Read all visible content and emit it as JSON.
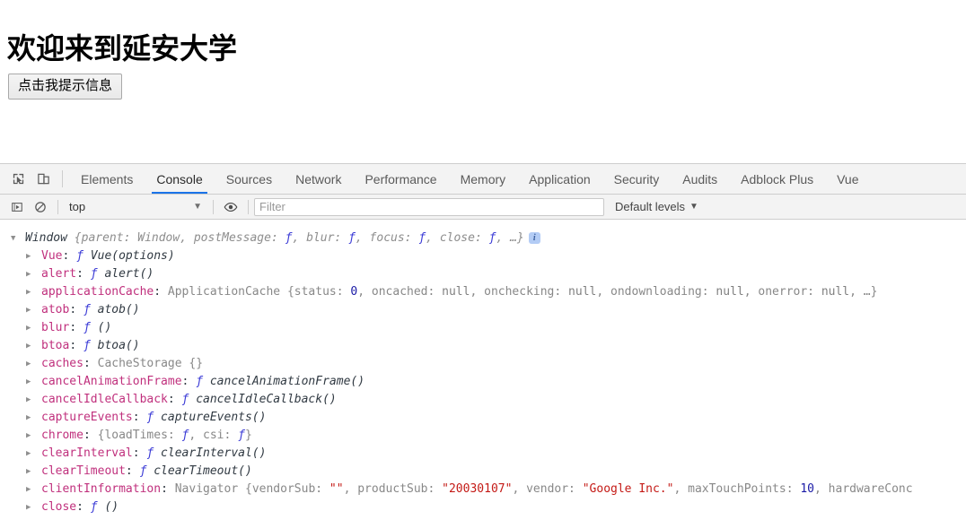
{
  "page": {
    "heading": "欢迎来到延安大学",
    "button_label": "点击我提示信息"
  },
  "devtools": {
    "icons": {
      "inspect": "inspect-element-icon",
      "device": "device-toolbar-icon",
      "execute": "execute-snippet-icon",
      "clear": "clear-console-icon",
      "eye": "live-expression-icon"
    },
    "tabs": [
      {
        "label": "Elements",
        "active": false
      },
      {
        "label": "Console",
        "active": true
      },
      {
        "label": "Sources",
        "active": false
      },
      {
        "label": "Network",
        "active": false
      },
      {
        "label": "Performance",
        "active": false
      },
      {
        "label": "Memory",
        "active": false
      },
      {
        "label": "Application",
        "active": false
      },
      {
        "label": "Security",
        "active": false
      },
      {
        "label": "Audits",
        "active": false
      },
      {
        "label": "Adblock Plus",
        "active": false
      },
      {
        "label": "Vue",
        "active": false
      }
    ],
    "filterbar": {
      "context": "top",
      "caret": "▼",
      "filter_placeholder": "Filter",
      "filter_value": "",
      "levels": "Default levels",
      "levels_caret": "▼"
    },
    "colors": {
      "accent": "#1a73e8",
      "property": "#c0307d",
      "string": "#c41a16",
      "number": "#1a1aa6",
      "function": "#3b3bd6",
      "dim": "#8d8d8d",
      "toolbar_bg": "#f3f3f3",
      "border": "#cdcdcd"
    },
    "console_rows": [
      {
        "indent": "root",
        "arrow": "▼",
        "badge": "i",
        "segments": [
          {
            "t": "Window ",
            "c": "k-win"
          },
          {
            "t": "{parent: Window, postMessage: ",
            "c": "k-type"
          },
          {
            "t": "ƒ",
            "c": "k-fn"
          },
          {
            "t": ", blur: ",
            "c": "k-type"
          },
          {
            "t": "ƒ",
            "c": "k-fn"
          },
          {
            "t": ", focus: ",
            "c": "k-type"
          },
          {
            "t": "ƒ",
            "c": "k-fn"
          },
          {
            "t": ", close: ",
            "c": "k-type"
          },
          {
            "t": "ƒ",
            "c": "k-fn"
          },
          {
            "t": ", …}",
            "c": "k-type"
          }
        ]
      },
      {
        "indent": "child",
        "arrow": "▶",
        "badge": "",
        "segments": [
          {
            "t": "Vue",
            "c": "k-prop"
          },
          {
            "t": ": ",
            "c": "k-punc"
          },
          {
            "t": "ƒ",
            "c": "k-fn"
          },
          {
            "t": " Vue(options)",
            "c": "k-fname"
          }
        ]
      },
      {
        "indent": "child",
        "arrow": "▶",
        "badge": "",
        "segments": [
          {
            "t": "alert",
            "c": "k-prop"
          },
          {
            "t": ": ",
            "c": "k-punc"
          },
          {
            "t": "ƒ",
            "c": "k-fn"
          },
          {
            "t": " alert()",
            "c": "k-fname"
          }
        ]
      },
      {
        "indent": "child",
        "arrow": "▶",
        "badge": "",
        "segments": [
          {
            "t": "applicationCache",
            "c": "k-prop"
          },
          {
            "t": ": ",
            "c": "k-punc"
          },
          {
            "t": "ApplicationCache ",
            "c": "k-cls"
          },
          {
            "t": "{status: ",
            "c": "k-cls"
          },
          {
            "t": "0",
            "c": "k-num"
          },
          {
            "t": ", oncached: ",
            "c": "k-cls"
          },
          {
            "t": "null",
            "c": "k-null"
          },
          {
            "t": ", onchecking: ",
            "c": "k-cls"
          },
          {
            "t": "null",
            "c": "k-null"
          },
          {
            "t": ", ondownloading: ",
            "c": "k-cls"
          },
          {
            "t": "null",
            "c": "k-null"
          },
          {
            "t": ", onerror: ",
            "c": "k-cls"
          },
          {
            "t": "null",
            "c": "k-null"
          },
          {
            "t": ", …}",
            "c": "k-cls"
          }
        ]
      },
      {
        "indent": "child",
        "arrow": "▶",
        "badge": "",
        "segments": [
          {
            "t": "atob",
            "c": "k-prop"
          },
          {
            "t": ": ",
            "c": "k-punc"
          },
          {
            "t": "ƒ",
            "c": "k-fn"
          },
          {
            "t": " atob()",
            "c": "k-fname"
          }
        ]
      },
      {
        "indent": "child",
        "arrow": "▶",
        "badge": "",
        "segments": [
          {
            "t": "blur",
            "c": "k-prop"
          },
          {
            "t": ": ",
            "c": "k-punc"
          },
          {
            "t": "ƒ",
            "c": "k-fn"
          },
          {
            "t": " ()",
            "c": "k-fname"
          }
        ]
      },
      {
        "indent": "child",
        "arrow": "▶",
        "badge": "",
        "segments": [
          {
            "t": "btoa",
            "c": "k-prop"
          },
          {
            "t": ": ",
            "c": "k-punc"
          },
          {
            "t": "ƒ",
            "c": "k-fn"
          },
          {
            "t": " btoa()",
            "c": "k-fname"
          }
        ]
      },
      {
        "indent": "child",
        "arrow": "▶",
        "badge": "",
        "segments": [
          {
            "t": "caches",
            "c": "k-prop"
          },
          {
            "t": ": ",
            "c": "k-punc"
          },
          {
            "t": "CacheStorage {}",
            "c": "k-cls"
          }
        ]
      },
      {
        "indent": "child",
        "arrow": "▶",
        "badge": "",
        "segments": [
          {
            "t": "cancelAnimationFrame",
            "c": "k-prop"
          },
          {
            "t": ": ",
            "c": "k-punc"
          },
          {
            "t": "ƒ",
            "c": "k-fn"
          },
          {
            "t": " cancelAnimationFrame()",
            "c": "k-fname"
          }
        ]
      },
      {
        "indent": "child",
        "arrow": "▶",
        "badge": "",
        "segments": [
          {
            "t": "cancelIdleCallback",
            "c": "k-prop"
          },
          {
            "t": ": ",
            "c": "k-punc"
          },
          {
            "t": "ƒ",
            "c": "k-fn"
          },
          {
            "t": " cancelIdleCallback()",
            "c": "k-fname"
          }
        ]
      },
      {
        "indent": "child",
        "arrow": "▶",
        "badge": "",
        "segments": [
          {
            "t": "captureEvents",
            "c": "k-prop"
          },
          {
            "t": ": ",
            "c": "k-punc"
          },
          {
            "t": "ƒ",
            "c": "k-fn"
          },
          {
            "t": " captureEvents()",
            "c": "k-fname"
          }
        ]
      },
      {
        "indent": "child",
        "arrow": "▶",
        "badge": "",
        "segments": [
          {
            "t": "chrome",
            "c": "k-prop"
          },
          {
            "t": ": ",
            "c": "k-punc"
          },
          {
            "t": "{loadTimes: ",
            "c": "k-cls"
          },
          {
            "t": "ƒ",
            "c": "k-fn"
          },
          {
            "t": ", csi: ",
            "c": "k-cls"
          },
          {
            "t": "ƒ",
            "c": "k-fn"
          },
          {
            "t": "}",
            "c": "k-cls"
          }
        ]
      },
      {
        "indent": "child",
        "arrow": "▶",
        "badge": "",
        "segments": [
          {
            "t": "clearInterval",
            "c": "k-prop"
          },
          {
            "t": ": ",
            "c": "k-punc"
          },
          {
            "t": "ƒ",
            "c": "k-fn"
          },
          {
            "t": " clearInterval()",
            "c": "k-fname"
          }
        ]
      },
      {
        "indent": "child",
        "arrow": "▶",
        "badge": "",
        "segments": [
          {
            "t": "clearTimeout",
            "c": "k-prop"
          },
          {
            "t": ": ",
            "c": "k-punc"
          },
          {
            "t": "ƒ",
            "c": "k-fn"
          },
          {
            "t": " clearTimeout()",
            "c": "k-fname"
          }
        ]
      },
      {
        "indent": "child",
        "arrow": "▶",
        "badge": "",
        "segments": [
          {
            "t": "clientInformation",
            "c": "k-prop"
          },
          {
            "t": ": ",
            "c": "k-punc"
          },
          {
            "t": "Navigator ",
            "c": "k-cls"
          },
          {
            "t": "{vendorSub: ",
            "c": "k-cls"
          },
          {
            "t": "\"\"",
            "c": "k-str"
          },
          {
            "t": ", productSub: ",
            "c": "k-cls"
          },
          {
            "t": "\"20030107\"",
            "c": "k-str"
          },
          {
            "t": ", vendor: ",
            "c": "k-cls"
          },
          {
            "t": "\"Google Inc.\"",
            "c": "k-str"
          },
          {
            "t": ", maxTouchPoints: ",
            "c": "k-cls"
          },
          {
            "t": "10",
            "c": "k-num"
          },
          {
            "t": ", hardwareConc",
            "c": "k-cls"
          }
        ]
      },
      {
        "indent": "child",
        "arrow": "▶",
        "badge": "",
        "segments": [
          {
            "t": "close",
            "c": "k-prop"
          },
          {
            "t": ": ",
            "c": "k-punc"
          },
          {
            "t": "ƒ",
            "c": "k-fn"
          },
          {
            "t": " ()",
            "c": "k-fname"
          }
        ]
      }
    ]
  }
}
